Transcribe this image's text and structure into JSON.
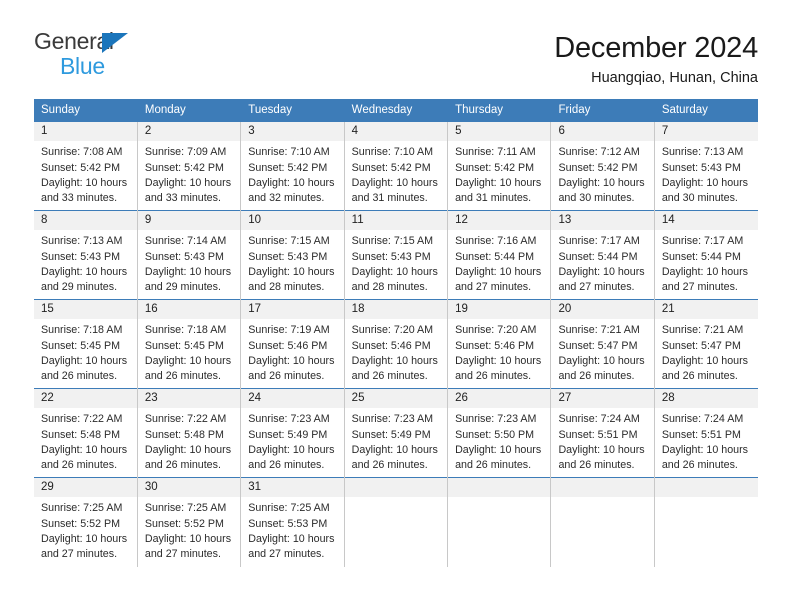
{
  "brand": {
    "name_dark": "General",
    "name_light": "Blue",
    "accent_dark": "#1b75bb",
    "accent_light": "#2e9ade"
  },
  "header": {
    "title": "December 2024",
    "subtitle": "Huangqiao, Hunan, China",
    "header_bg": "#3d7cb8",
    "header_text": "#ffffff"
  },
  "weekdays": [
    "Sunday",
    "Monday",
    "Tuesday",
    "Wednesday",
    "Thursday",
    "Friday",
    "Saturday"
  ],
  "weeks": [
    [
      {
        "day": "1",
        "sunrise": "Sunrise: 7:08 AM",
        "sunset": "Sunset: 5:42 PM",
        "daylight1": "Daylight: 10 hours",
        "daylight2": "and 33 minutes."
      },
      {
        "day": "2",
        "sunrise": "Sunrise: 7:09 AM",
        "sunset": "Sunset: 5:42 PM",
        "daylight1": "Daylight: 10 hours",
        "daylight2": "and 33 minutes."
      },
      {
        "day": "3",
        "sunrise": "Sunrise: 7:10 AM",
        "sunset": "Sunset: 5:42 PM",
        "daylight1": "Daylight: 10 hours",
        "daylight2": "and 32 minutes."
      },
      {
        "day": "4",
        "sunrise": "Sunrise: 7:10 AM",
        "sunset": "Sunset: 5:42 PM",
        "daylight1": "Daylight: 10 hours",
        "daylight2": "and 31 minutes."
      },
      {
        "day": "5",
        "sunrise": "Sunrise: 7:11 AM",
        "sunset": "Sunset: 5:42 PM",
        "daylight1": "Daylight: 10 hours",
        "daylight2": "and 31 minutes."
      },
      {
        "day": "6",
        "sunrise": "Sunrise: 7:12 AM",
        "sunset": "Sunset: 5:42 PM",
        "daylight1": "Daylight: 10 hours",
        "daylight2": "and 30 minutes."
      },
      {
        "day": "7",
        "sunrise": "Sunrise: 7:13 AM",
        "sunset": "Sunset: 5:43 PM",
        "daylight1": "Daylight: 10 hours",
        "daylight2": "and 30 minutes."
      }
    ],
    [
      {
        "day": "8",
        "sunrise": "Sunrise: 7:13 AM",
        "sunset": "Sunset: 5:43 PM",
        "daylight1": "Daylight: 10 hours",
        "daylight2": "and 29 minutes."
      },
      {
        "day": "9",
        "sunrise": "Sunrise: 7:14 AM",
        "sunset": "Sunset: 5:43 PM",
        "daylight1": "Daylight: 10 hours",
        "daylight2": "and 29 minutes."
      },
      {
        "day": "10",
        "sunrise": "Sunrise: 7:15 AM",
        "sunset": "Sunset: 5:43 PM",
        "daylight1": "Daylight: 10 hours",
        "daylight2": "and 28 minutes."
      },
      {
        "day": "11",
        "sunrise": "Sunrise: 7:15 AM",
        "sunset": "Sunset: 5:43 PM",
        "daylight1": "Daylight: 10 hours",
        "daylight2": "and 28 minutes."
      },
      {
        "day": "12",
        "sunrise": "Sunrise: 7:16 AM",
        "sunset": "Sunset: 5:44 PM",
        "daylight1": "Daylight: 10 hours",
        "daylight2": "and 27 minutes."
      },
      {
        "day": "13",
        "sunrise": "Sunrise: 7:17 AM",
        "sunset": "Sunset: 5:44 PM",
        "daylight1": "Daylight: 10 hours",
        "daylight2": "and 27 minutes."
      },
      {
        "day": "14",
        "sunrise": "Sunrise: 7:17 AM",
        "sunset": "Sunset: 5:44 PM",
        "daylight1": "Daylight: 10 hours",
        "daylight2": "and 27 minutes."
      }
    ],
    [
      {
        "day": "15",
        "sunrise": "Sunrise: 7:18 AM",
        "sunset": "Sunset: 5:45 PM",
        "daylight1": "Daylight: 10 hours",
        "daylight2": "and 26 minutes."
      },
      {
        "day": "16",
        "sunrise": "Sunrise: 7:18 AM",
        "sunset": "Sunset: 5:45 PM",
        "daylight1": "Daylight: 10 hours",
        "daylight2": "and 26 minutes."
      },
      {
        "day": "17",
        "sunrise": "Sunrise: 7:19 AM",
        "sunset": "Sunset: 5:46 PM",
        "daylight1": "Daylight: 10 hours",
        "daylight2": "and 26 minutes."
      },
      {
        "day": "18",
        "sunrise": "Sunrise: 7:20 AM",
        "sunset": "Sunset: 5:46 PM",
        "daylight1": "Daylight: 10 hours",
        "daylight2": "and 26 minutes."
      },
      {
        "day": "19",
        "sunrise": "Sunrise: 7:20 AM",
        "sunset": "Sunset: 5:46 PM",
        "daylight1": "Daylight: 10 hours",
        "daylight2": "and 26 minutes."
      },
      {
        "day": "20",
        "sunrise": "Sunrise: 7:21 AM",
        "sunset": "Sunset: 5:47 PM",
        "daylight1": "Daylight: 10 hours",
        "daylight2": "and 26 minutes."
      },
      {
        "day": "21",
        "sunrise": "Sunrise: 7:21 AM",
        "sunset": "Sunset: 5:47 PM",
        "daylight1": "Daylight: 10 hours",
        "daylight2": "and 26 minutes."
      }
    ],
    [
      {
        "day": "22",
        "sunrise": "Sunrise: 7:22 AM",
        "sunset": "Sunset: 5:48 PM",
        "daylight1": "Daylight: 10 hours",
        "daylight2": "and 26 minutes."
      },
      {
        "day": "23",
        "sunrise": "Sunrise: 7:22 AM",
        "sunset": "Sunset: 5:48 PM",
        "daylight1": "Daylight: 10 hours",
        "daylight2": "and 26 minutes."
      },
      {
        "day": "24",
        "sunrise": "Sunrise: 7:23 AM",
        "sunset": "Sunset: 5:49 PM",
        "daylight1": "Daylight: 10 hours",
        "daylight2": "and 26 minutes."
      },
      {
        "day": "25",
        "sunrise": "Sunrise: 7:23 AM",
        "sunset": "Sunset: 5:49 PM",
        "daylight1": "Daylight: 10 hours",
        "daylight2": "and 26 minutes."
      },
      {
        "day": "26",
        "sunrise": "Sunrise: 7:23 AM",
        "sunset": "Sunset: 5:50 PM",
        "daylight1": "Daylight: 10 hours",
        "daylight2": "and 26 minutes."
      },
      {
        "day": "27",
        "sunrise": "Sunrise: 7:24 AM",
        "sunset": "Sunset: 5:51 PM",
        "daylight1": "Daylight: 10 hours",
        "daylight2": "and 26 minutes."
      },
      {
        "day": "28",
        "sunrise": "Sunrise: 7:24 AM",
        "sunset": "Sunset: 5:51 PM",
        "daylight1": "Daylight: 10 hours",
        "daylight2": "and 26 minutes."
      }
    ],
    [
      {
        "day": "29",
        "sunrise": "Sunrise: 7:25 AM",
        "sunset": "Sunset: 5:52 PM",
        "daylight1": "Daylight: 10 hours",
        "daylight2": "and 27 minutes."
      },
      {
        "day": "30",
        "sunrise": "Sunrise: 7:25 AM",
        "sunset": "Sunset: 5:52 PM",
        "daylight1": "Daylight: 10 hours",
        "daylight2": "and 27 minutes."
      },
      {
        "day": "31",
        "sunrise": "Sunrise: 7:25 AM",
        "sunset": "Sunset: 5:53 PM",
        "daylight1": "Daylight: 10 hours",
        "daylight2": "and 27 minutes."
      },
      {
        "day": "",
        "sunrise": "",
        "sunset": "",
        "daylight1": "",
        "daylight2": ""
      },
      {
        "day": "",
        "sunrise": "",
        "sunset": "",
        "daylight1": "",
        "daylight2": ""
      },
      {
        "day": "",
        "sunrise": "",
        "sunset": "",
        "daylight1": "",
        "daylight2": ""
      },
      {
        "day": "",
        "sunrise": "",
        "sunset": "",
        "daylight1": "",
        "daylight2": ""
      }
    ]
  ]
}
